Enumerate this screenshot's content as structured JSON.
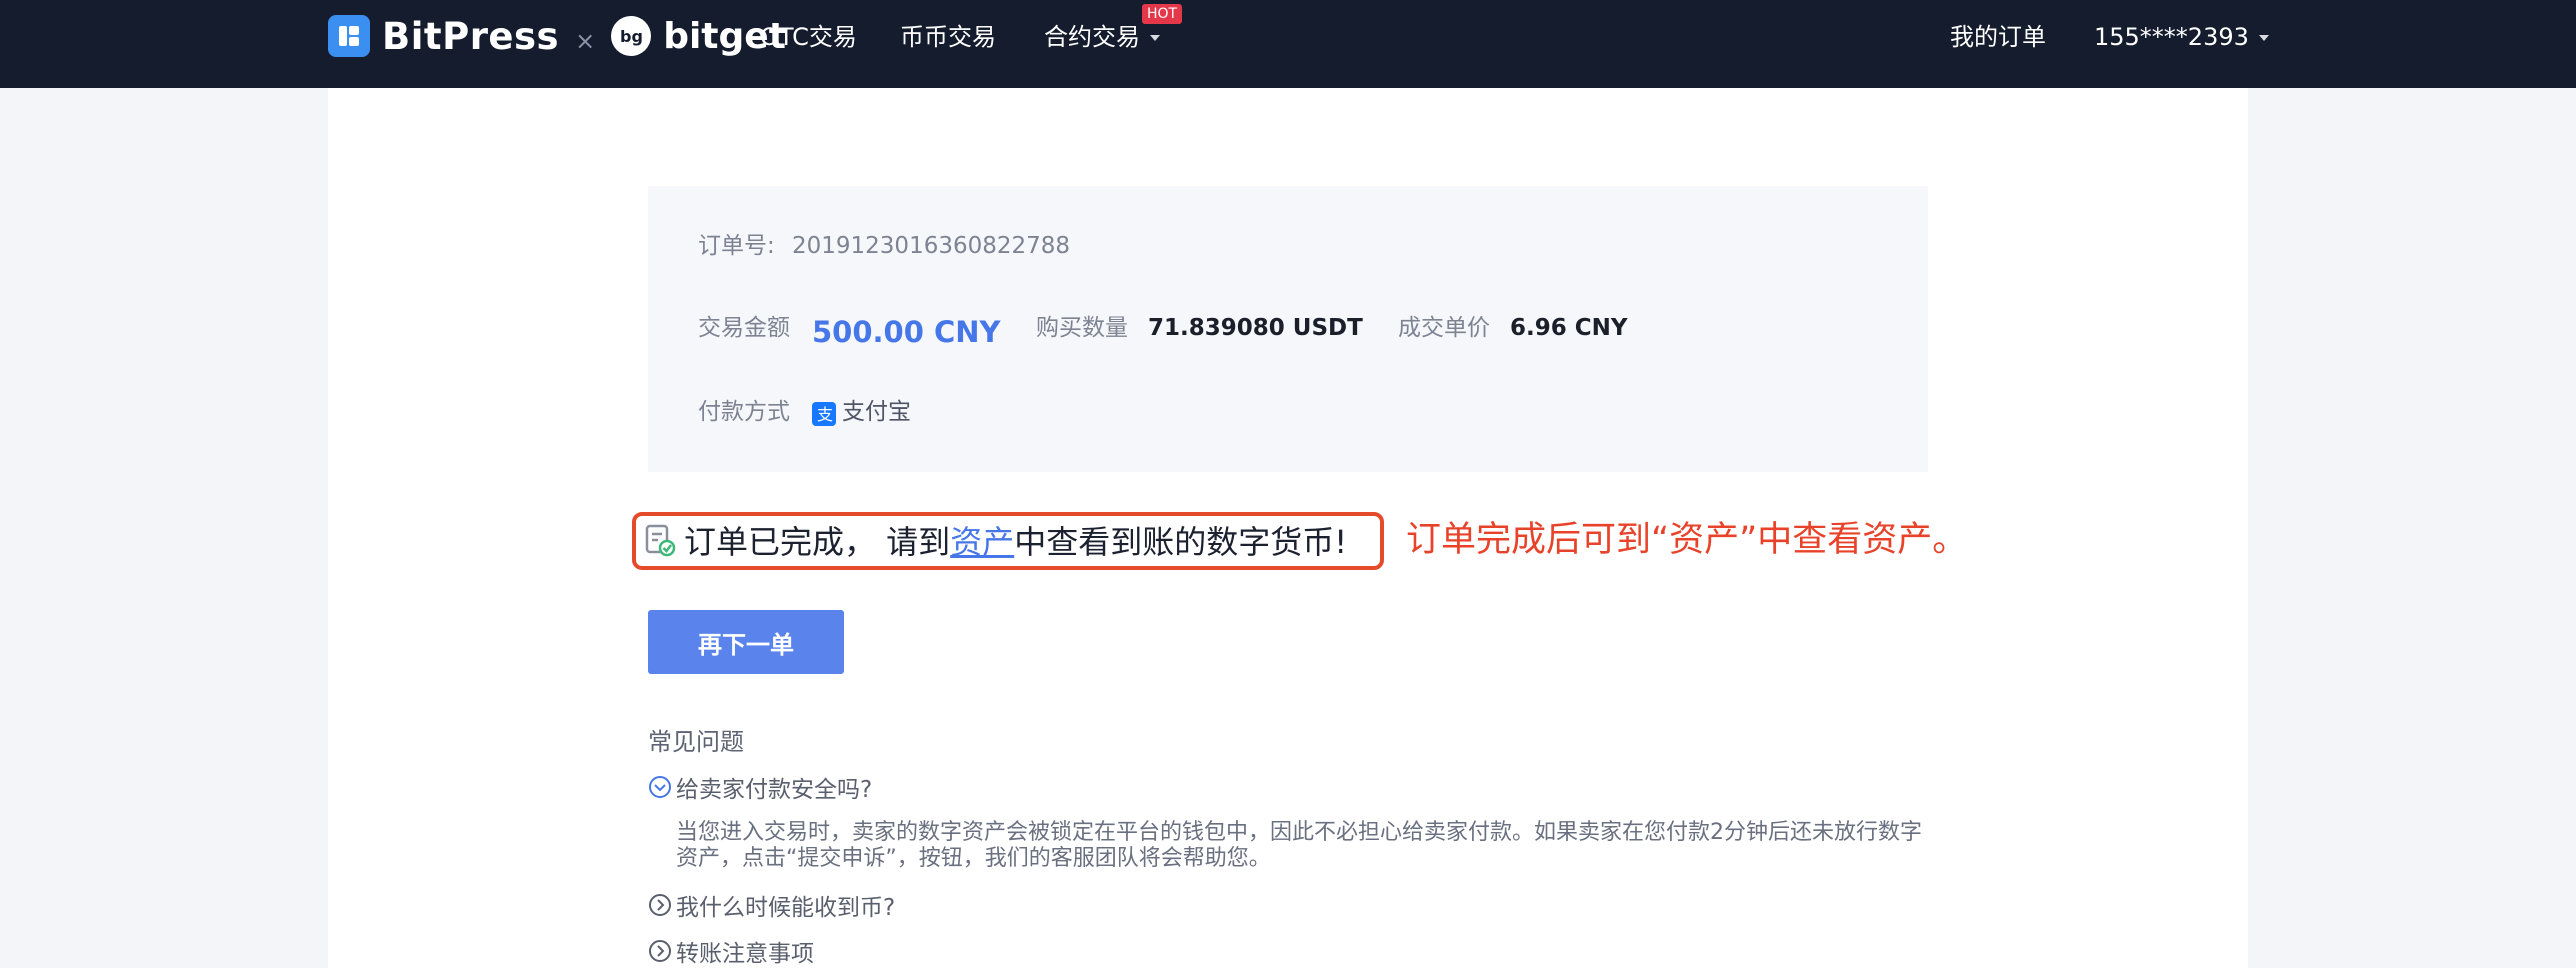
{
  "header": {
    "brand_bitpress": "BitPress",
    "brand_separator": "×",
    "brand_bitget": "bitget",
    "nav": {
      "otc": "OTC交易",
      "spot": "币币交易",
      "contract": "合约交易",
      "hot_badge": "HOT"
    },
    "my_orders": "我的订单",
    "user": "155****2393"
  },
  "order": {
    "id_label": "订单号:",
    "id_value": "2019123016360822788",
    "amount_label": "交易金额",
    "amount_value": "500.00 CNY",
    "qty_label": "购买数量",
    "qty_value": "71.839080 USDT",
    "price_label": "成交单价",
    "price_value": "6.96 CNY",
    "payment_label": "付款方式",
    "payment_value": "支付宝"
  },
  "notice": {
    "prefix": "订单已完成， 请到",
    "link": "资产",
    "suffix": "中查看到账的数字货币!"
  },
  "annotation": "订单完成后可到“资产”中查看资产。",
  "actions": {
    "reorder": "再下一单"
  },
  "faq": {
    "title": "常见问题",
    "items": [
      {
        "q": "给卖家付款安全吗?",
        "a": "当您进入交易时，卖家的数字资产会被锁定在平台的钱包中，因此不必担心给卖家付款。如果卖家在您付款2分钟后还未放行数字资产，点击“提交申诉”，按钮，我们的客服团队将会帮助您。",
        "expanded": true
      },
      {
        "q": "我什么时候能收到币?",
        "expanded": false
      },
      {
        "q": "转账注意事项",
        "expanded": false
      }
    ]
  },
  "colors": {
    "header_bg": "#151c2e",
    "accent_blue": "#4677e8",
    "button_blue": "#5a84ec",
    "annotation_red": "#e8432a",
    "hot_red": "#e5374a"
  },
  "icons": [
    "bitpress-logo-icon",
    "bitget-logo-icon",
    "alipay-icon",
    "order-complete-icon",
    "chevron-down-circle-icon",
    "chevron-right-circle-icon"
  ]
}
